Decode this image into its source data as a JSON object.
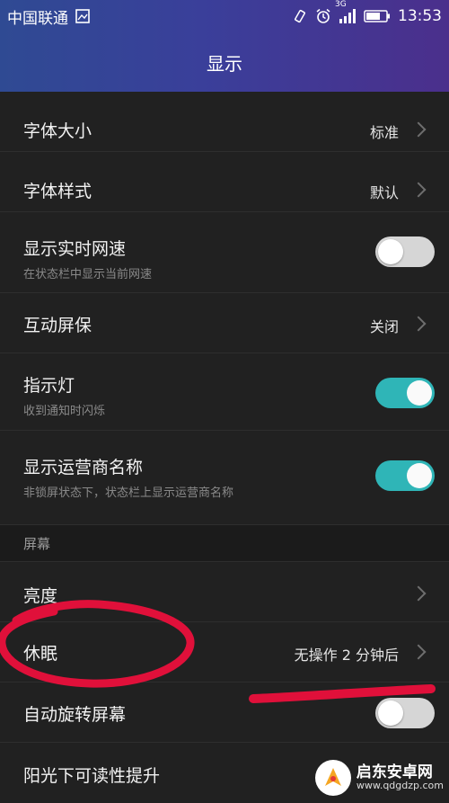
{
  "status_bar": {
    "carrier": "中国联通",
    "network": "3G",
    "time": "13:53"
  },
  "header": {
    "title": "显示"
  },
  "settings": {
    "font_size": {
      "label": "字体大小",
      "value": "标准"
    },
    "font_style": {
      "label": "字体样式",
      "value": "默认"
    },
    "network_speed": {
      "label": "显示实时网速",
      "sub": "在状态栏中显示当前网速",
      "enabled": false
    },
    "interactive_screensaver": {
      "label": "互动屏保",
      "value": "关闭"
    },
    "indicator_light": {
      "label": "指示灯",
      "sub": "收到通知时闪烁",
      "enabled": true
    },
    "carrier_name": {
      "label": "显示运营商名称",
      "sub": "非锁屏状态下，状态栏上显示运营商名称",
      "enabled": true
    },
    "screen_section": {
      "label": "屏幕"
    },
    "brightness": {
      "label": "亮度"
    },
    "sleep": {
      "label": "休眠",
      "value": "无操作 2 分钟后"
    },
    "auto_rotate": {
      "label": "自动旋转屏幕",
      "enabled": false
    },
    "sunlight_readability": {
      "label": "阳光下可读性提升"
    }
  },
  "watermark": {
    "name": "启东安卓网",
    "url": "www.qdgdzp.com"
  },
  "colors": {
    "header_start": "#2f4a93",
    "header_end": "#4b2f8c",
    "background": "#212121",
    "toggle_on": "#2fb5b7",
    "annotation": "#e0103a"
  }
}
